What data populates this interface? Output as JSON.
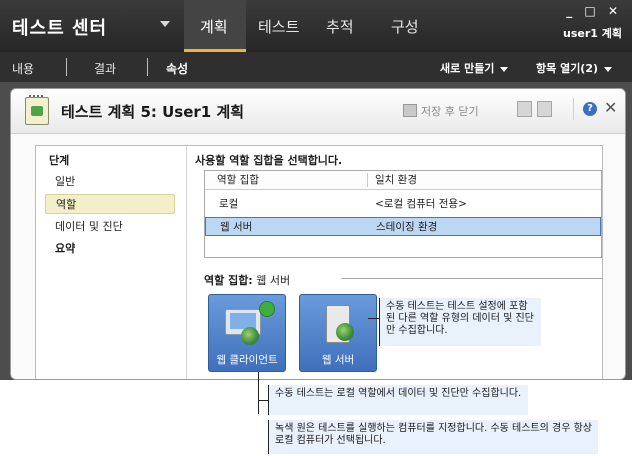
{
  "app": {
    "title": "테스트 센터",
    "user": "user1 계획",
    "window_controls": "_ □ ✕"
  },
  "nav": {
    "tabs": [
      "계획",
      "테스트",
      "추적",
      "구성"
    ],
    "active": "계획"
  },
  "subnav": {
    "items": [
      "내용",
      "결과",
      "속성"
    ],
    "active": "속성",
    "new_label": "새로 만들기",
    "open_label": "항목 열기(2)"
  },
  "panel": {
    "title": "테스트 계획 5: User1 계획",
    "save_close": "저장 후 닫기"
  },
  "steps": {
    "title": "단계",
    "items": [
      "일반",
      "역할",
      "데이터 및 진단",
      "요약"
    ],
    "selected": "역할"
  },
  "roles": {
    "heading": "사용할 역할 집합을 선택합니다.",
    "columns": [
      "역할 집합",
      "일치 환경"
    ],
    "rows": [
      {
        "set": "로컬",
        "env": "<로컬 컴퓨터 전용>"
      },
      {
        "set": "웹 서버",
        "env": "스테이징 환경"
      }
    ],
    "selected_row": "웹 서버"
  },
  "role_set": {
    "label": "역할 집합:",
    "value": "웹 서버",
    "tiles": [
      "웹 클라이언트",
      "웹 서버"
    ]
  },
  "callouts": {
    "right": "수동 테스트는 테스트 설정에 포함된 다른 역할 유형의 데이터 및 진단만 수집합니다.",
    "bottom1": "수동 테스트는 로컬 역할에서 데이터 및 진단만 수집합니다.",
    "bottom2": "녹색 원은 테스트를 실행하는 컴퓨터를 지정합니다. 수동 테스트의 경우 항상 로컬 컴퓨터가 선택됩니다."
  }
}
